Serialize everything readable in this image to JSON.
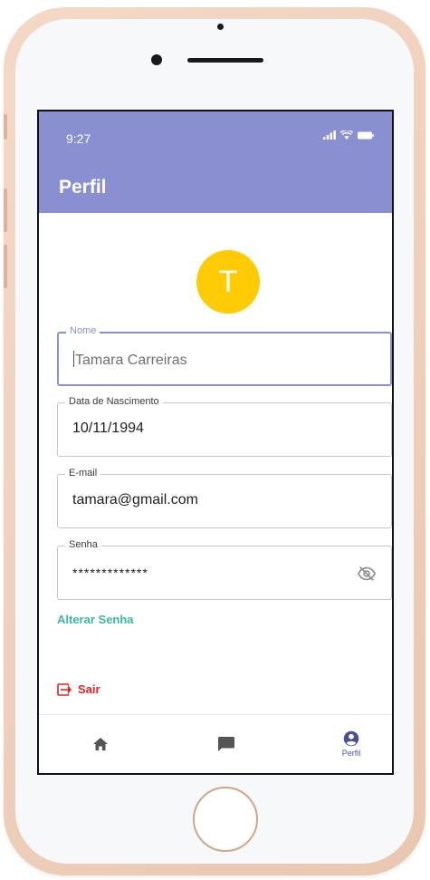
{
  "status_bar": {
    "time": "9:27"
  },
  "app_bar": {
    "title": "Perfil"
  },
  "profile": {
    "avatar_initial": "T",
    "avatar_color": "#ffcb05"
  },
  "form": {
    "nome": {
      "label": "Nome",
      "value": "Tamara Carreiras"
    },
    "data_nascimento": {
      "label": "Data de Nascimento",
      "value": "10/11/1994"
    },
    "email": {
      "label": "E-mail",
      "value": "tamara@gmail.com"
    },
    "senha": {
      "label": "Senha",
      "value": "*************",
      "toggle_icon": "eye-off-icon"
    }
  },
  "actions": {
    "alterar_senha": "Alterar Senha",
    "sair": "Sair",
    "sair_icon": "logout-icon"
  },
  "bottom_nav": {
    "items": [
      {
        "icon": "home-icon",
        "label": ""
      },
      {
        "icon": "chat-icon",
        "label": ""
      },
      {
        "icon": "account-circle-icon",
        "label": "Perfil"
      }
    ],
    "active_index": 2
  },
  "colors": {
    "primary": "#8a8fd1",
    "link": "#3db7a4",
    "danger": "#e02424",
    "nav_active": "#4c4f93"
  }
}
